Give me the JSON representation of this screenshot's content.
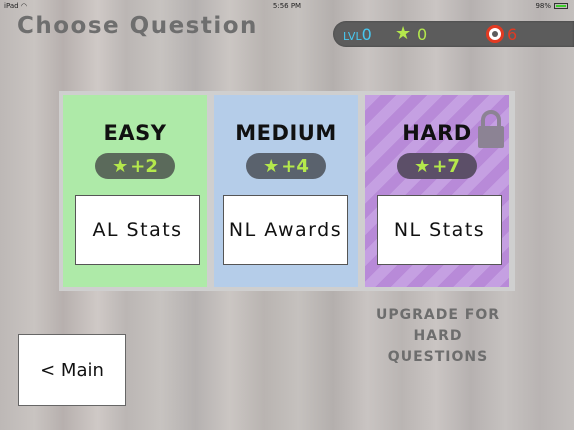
{
  "status_bar": {
    "device": "iPad",
    "time": "5:56 PM",
    "battery": "98%",
    "battery_level": 0.98
  },
  "title": "Choose Question",
  "hud": {
    "level_label": "LVL",
    "level": "0",
    "stars": "0",
    "lives": "6",
    "icons": [
      "star-icon",
      "life-ring-icon"
    ]
  },
  "cards": [
    {
      "difficulty": "EASY",
      "reward": "+2",
      "question": "AL Stats",
      "locked": false,
      "color": "#aeeaa8"
    },
    {
      "difficulty": "MEDIUM",
      "reward": "+4",
      "question": "NL Awards",
      "locked": false,
      "color": "#b5cde9"
    },
    {
      "difficulty": "HARD",
      "reward": "+7",
      "question": "NL Stats",
      "locked": true,
      "color": "#c5a0e2"
    }
  ],
  "upgrade": {
    "line1": "UPGRADE FOR",
    "line2": "HARD",
    "line3": "QUESTIONS"
  },
  "main_button": "< Main",
  "colors": {
    "accent_green": "#b4e84c",
    "level_blue": "#48c8f0",
    "lives_red": "#e23a22",
    "hud_bg": "#5c5c5c"
  }
}
